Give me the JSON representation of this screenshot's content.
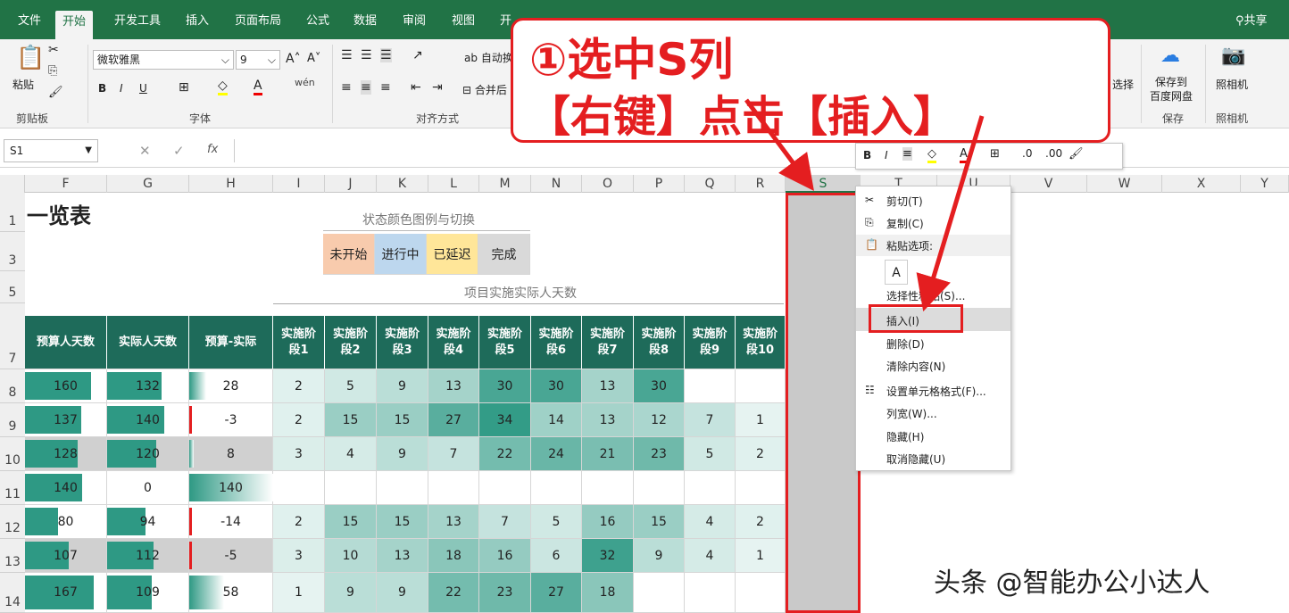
{
  "tabs": [
    "文件",
    "开始",
    "开发工具",
    "插入",
    "页面布局",
    "公式",
    "数据",
    "审阅",
    "视图",
    "开"
  ],
  "share": "共享",
  "ribbon": {
    "paste": "粘贴",
    "clipboard": "剪贴板",
    "font_name": "微软雅黑",
    "font_size": "9",
    "font_group": "字体",
    "align_group": "对齐方式",
    "wrap": "自动换",
    "merge": "合并后",
    "select_btn": "选择",
    "baidu": "保存到\n百度网盘",
    "baidu_group": "保存",
    "camera": "照相机",
    "camera_group": "照相机",
    "bold": "B",
    "italic": "I",
    "underline": "U",
    "wen": "wén"
  },
  "name_box": "S1",
  "fx": "fx",
  "columns": [
    "F",
    "G",
    "H",
    "I",
    "J",
    "K",
    "L",
    "M",
    "N",
    "O",
    "P",
    "Q",
    "R",
    "S",
    "T",
    "U",
    "V",
    "W",
    "X",
    "Y"
  ],
  "rows": [
    "1",
    "3",
    "5",
    "7",
    "8",
    "9",
    "10",
    "11",
    "12",
    "13",
    "14"
  ],
  "title_frag": "一览表",
  "legend": {
    "title": "状态颜色图例与切换",
    "items": [
      "未开始",
      "进行中",
      "已延迟",
      "完成"
    ],
    "colors": [
      "#f8cbad",
      "#bdd7ee",
      "#ffe699",
      "#d9d9d9"
    ]
  },
  "section_title": "项目实施实际人天数",
  "table_headers": [
    "预算人天数",
    "实际人天数",
    "预算-实际",
    "实施阶\n段1",
    "实施阶\n段2",
    "实施阶\n段3",
    "实施阶\n段4",
    "实施阶\n段5",
    "实施阶\n段6",
    "实施阶\n段7",
    "实施阶\n段8",
    "实施阶\n段9",
    "实施阶\n段10"
  ],
  "table_rows": [
    [
      "160",
      "132",
      "28",
      "2",
      "5",
      "9",
      "13",
      "30",
      "30",
      "13",
      "30",
      "",
      ""
    ],
    [
      "137",
      "140",
      "-3",
      "2",
      "15",
      "15",
      "27",
      "34",
      "14",
      "13",
      "12",
      "7",
      "1"
    ],
    [
      "128",
      "120",
      "8",
      "3",
      "4",
      "9",
      "7",
      "22",
      "24",
      "21",
      "23",
      "5",
      "2"
    ],
    [
      "140",
      "0",
      "140",
      "",
      "",
      "",
      "",
      "",
      "",
      "",
      "",
      "",
      ""
    ],
    [
      "80",
      "94",
      "-14",
      "2",
      "15",
      "15",
      "13",
      "7",
      "5",
      "16",
      "15",
      "4",
      "2"
    ],
    [
      "107",
      "112",
      "-5",
      "3",
      "10",
      "13",
      "18",
      "16",
      "6",
      "32",
      "9",
      "4",
      "1"
    ],
    [
      "167",
      "109",
      "58",
      "1",
      "9",
      "9",
      "22",
      "23",
      "27",
      "18",
      "",
      "",
      ""
    ]
  ],
  "context_menu": [
    "剪切(T)",
    "复制(C)",
    "粘贴选项:",
    "选择性粘贴(S)...",
    "插入(I)",
    "删除(D)",
    "清除内容(N)",
    "设置单元格格式(F)...",
    "列宽(W)...",
    "隐藏(H)",
    "取消隐藏(U)"
  ],
  "callout": {
    "line1": "①选中S列",
    "line2": "【右键】点击【插入】"
  },
  "watermark": "头条 @智能办公小达人"
}
